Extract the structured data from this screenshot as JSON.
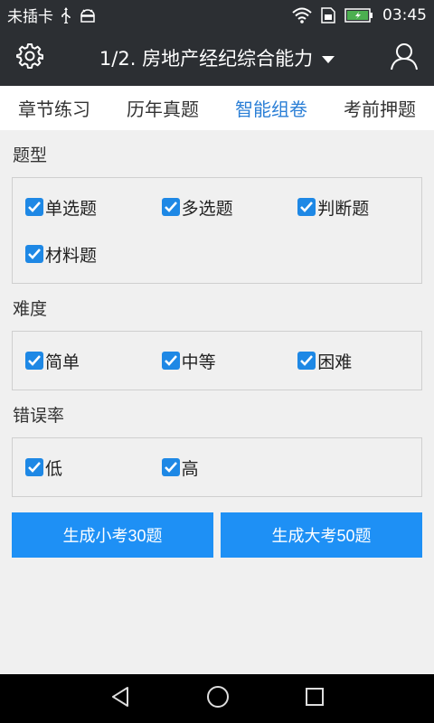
{
  "status_bar": {
    "carrier": "未插卡",
    "time": "03:45",
    "icons": [
      "usb-icon",
      "android-debug-icon",
      "wifi-icon",
      "sim-icon",
      "battery-charging-icon"
    ]
  },
  "app_bar": {
    "title": "1/2. 房地产经纪综合能力",
    "icons": [
      "settings-icon",
      "dropdown-icon",
      "user-icon"
    ]
  },
  "tabs": [
    {
      "label": "章节练习",
      "active": false
    },
    {
      "label": "历年真题",
      "active": false
    },
    {
      "label": "智能组卷",
      "active": true
    },
    {
      "label": "考前押题",
      "active": false
    }
  ],
  "sections": {
    "type": {
      "title": "题型",
      "options": [
        {
          "label": "单选题",
          "checked": true
        },
        {
          "label": "多选题",
          "checked": true
        },
        {
          "label": "判断题",
          "checked": true
        },
        {
          "label": "材料题",
          "checked": true
        }
      ]
    },
    "difficulty": {
      "title": "难度",
      "options": [
        {
          "label": "简单",
          "checked": true
        },
        {
          "label": "中等",
          "checked": true
        },
        {
          "label": "困难",
          "checked": true
        }
      ]
    },
    "error_rate": {
      "title": "错误率",
      "options": [
        {
          "label": "低",
          "checked": true
        },
        {
          "label": "高",
          "checked": true
        }
      ]
    }
  },
  "buttons": {
    "small_exam": "生成小考30题",
    "big_exam": "生成大考50题"
  },
  "colors": {
    "accent": "#1e90f5",
    "active_tab": "#2b7fd6",
    "bar_bg": "#2c2f33"
  }
}
